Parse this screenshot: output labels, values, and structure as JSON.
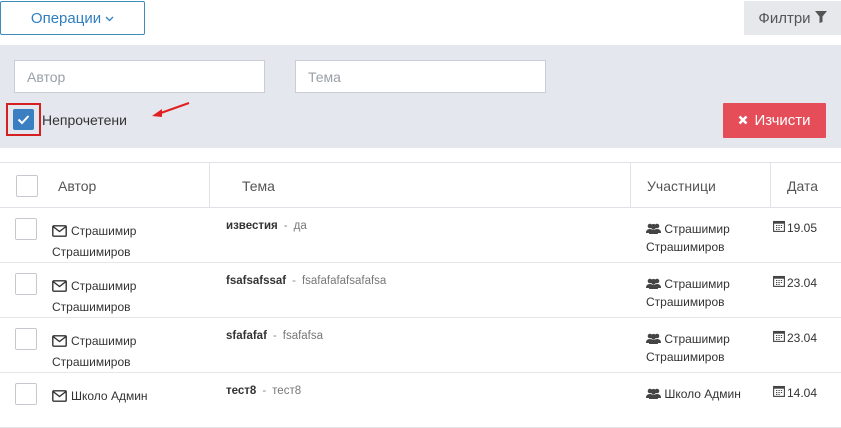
{
  "toolbar": {
    "operations_label": "Операции",
    "filters_label": "Филтри"
  },
  "filters": {
    "author_placeholder": "Автор",
    "topic_placeholder": "Тема",
    "unread_label": "Непрочетени",
    "unread_checked": true,
    "clear_label": "Изчисти"
  },
  "colors": {
    "accent": "#3a7fc1",
    "danger": "#e54d59",
    "highlight": "#d42020",
    "panel": "#e4e7ee"
  },
  "table": {
    "headers": {
      "author": "Автор",
      "topic": "Тема",
      "participants": "Участници",
      "date": "Дата"
    },
    "rows": [
      {
        "author_first": "Страшимир",
        "author_last": "Страшимиров",
        "subject": "известия",
        "preview": "да",
        "participant_first": "Страшимир",
        "participant_last": "Страшимиров",
        "date": "19.05"
      },
      {
        "author_first": "Страшимир",
        "author_last": "Страшимиров",
        "subject": "fsafsafssaf",
        "preview": "fsafafafafsafafsa",
        "participant_first": "Страшимир",
        "participant_last": "Страшимиров",
        "date": "23.04"
      },
      {
        "author_first": "Страшимир",
        "author_last": "Страшимиров",
        "subject": "sfafafaf",
        "preview": "fsafafsa",
        "participant_first": "Страшимир",
        "participant_last": "Страшимиров",
        "date": "23.04"
      },
      {
        "author_first": "Школо Админ",
        "author_last": "",
        "subject": "тест8",
        "preview": "тест8",
        "participant_first": "Школо Админ",
        "participant_last": "",
        "date": "14.04"
      }
    ]
  },
  "icons": {
    "operations": "chevron-down-icon",
    "filters": "filter-icon",
    "clear": "close-icon",
    "author": "envelope-icon",
    "participants": "users-icon",
    "date": "calendar-icon"
  }
}
